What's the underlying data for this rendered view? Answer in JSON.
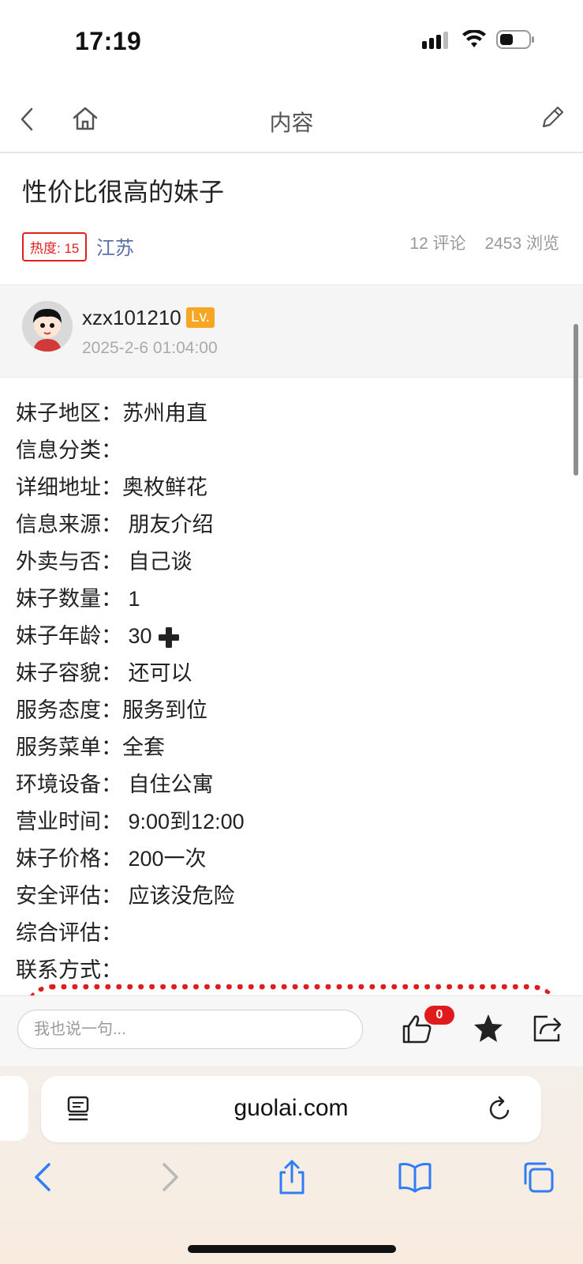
{
  "status": {
    "time": "17:19"
  },
  "nav": {
    "title": "内容"
  },
  "post": {
    "title": "性价比很高的妹子",
    "heat_label": "热度: 15",
    "region": "江苏",
    "comments": "12 评论",
    "views": "2453 浏览"
  },
  "author": {
    "username": "xzx101210",
    "level": "Lv.",
    "date": "2025-2-6 01:04:00"
  },
  "content_lines": [
    "妹子地区：苏州甪直",
    "信息分类：",
    "详细地址：奥枚鲜花",
    "信息来源： 朋友介绍",
    "外卖与否： 自己谈",
    "妹子数量： 1",
    "妹子年龄： 30",
    "妹子容貌： 还可以",
    "服务态度：服务到位",
    "服务菜单：全套",
    "环境设备： 自住公寓",
    "营业时间： 9:00到12:00",
    "妹子价格： 200一次",
    "安全评估： 应该没危险",
    "综合评估：",
    "联系方式："
  ],
  "comment_bar": {
    "placeholder": "我也说一句...",
    "like_count": "0"
  },
  "safari": {
    "url": "guolai.com"
  },
  "icons": {
    "back": "chevron-left-icon",
    "home": "home-icon",
    "edit": "pencil-icon",
    "like": "thumbs-up-icon",
    "star": "star-icon",
    "share": "share-icon",
    "reader": "reader-icon",
    "reload": "reload-icon"
  },
  "colors": {
    "accent_red": "#e01b1b",
    "link_blue": "#5b6fa8",
    "level_orange": "#f6a623",
    "safari_blue": "#2f7cf6"
  }
}
